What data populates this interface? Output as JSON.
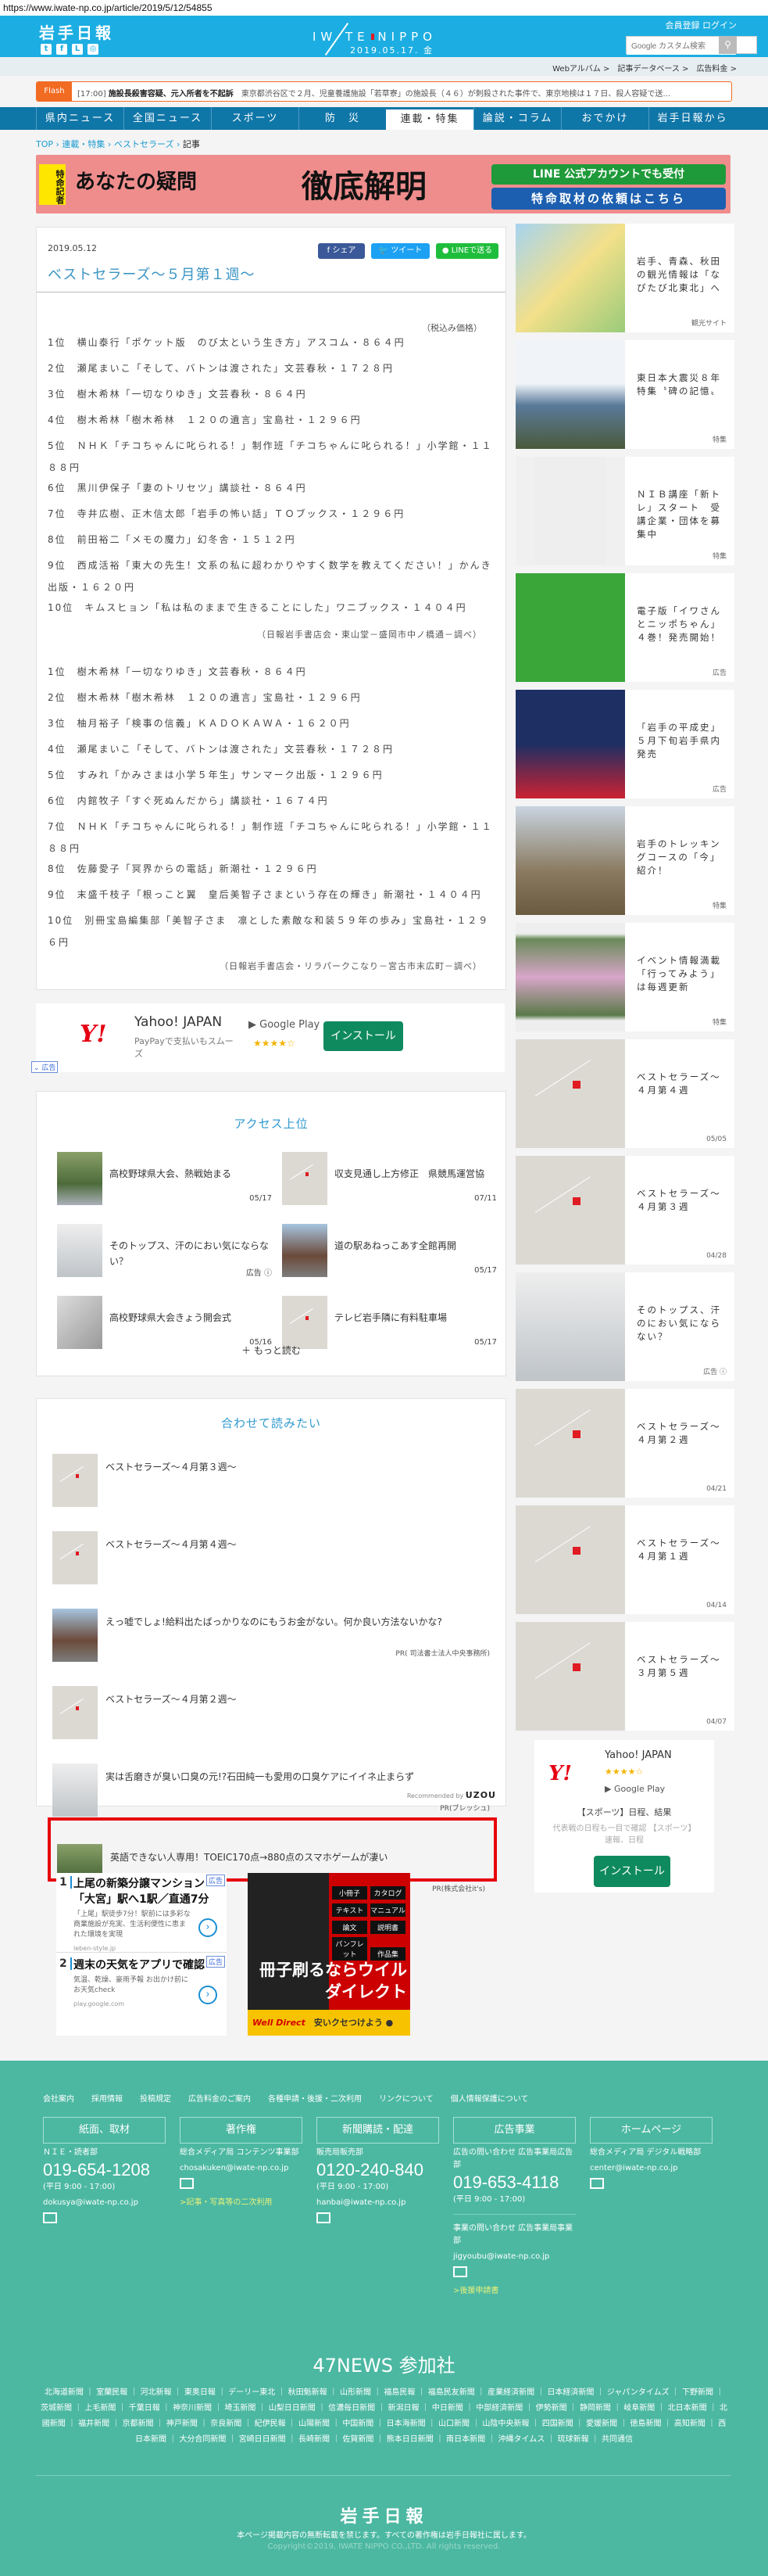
{
  "url": "https://www.iwate-np.co.jp/article/2019/5/12/54855",
  "header": {
    "logo_jp": "岩手日報",
    "brand": "IW  TE NIPPO",
    "date": "2019.05.17. 金",
    "account": "会員登録 ログイン",
    "search_placeholder": "Google カスタム検索",
    "search_icon": "search-icon",
    "social": [
      "twitter",
      "facebook",
      "line",
      "instagram"
    ]
  },
  "subnav": [
    "Webアルバム >",
    "記事データベース >",
    "広告料金 >"
  ],
  "flash": {
    "tag": "Flash",
    "time": "[17:00]",
    "headline": "施設長殺害容疑、元入所者を不起訴",
    "body": "東京都渋谷区で２月、児童養護施設「若草寮」の施設長（４６）が刺殺された事件で、東京地検は１７日、殺人容疑で送…"
  },
  "nav": [
    {
      "label": "県内ニュース"
    },
    {
      "label": "全国ニュース"
    },
    {
      "label": "スポーツ"
    },
    {
      "label": "防　災"
    },
    {
      "label": "連載・特集",
      "active": true
    },
    {
      "label": "論説・コラム"
    },
    {
      "label": "おでかけ"
    },
    {
      "label": "岩手日報から"
    }
  ],
  "breadcrumb": [
    "TOP",
    "連載・特集",
    "ベストセラーズ",
    "記事"
  ],
  "banner": {
    "tag": "特命記者",
    "text1": "あなたの疑問",
    "text2": "徹底解明",
    "line": "LINE 公式アカウントでも受付",
    "request": "特命取材の依頼はこちら"
  },
  "article": {
    "date": "2019.05.12",
    "title": "ベストセラーズ～５月第１週～",
    "share": {
      "facebook": "シェア",
      "twitter": "ツイート",
      "line": "LINEで送る"
    },
    "tax_note": "（税込み価格）",
    "list1": [
      "1位　横山泰行「ポケット版　のび太という生き方」アスコム・８６４円",
      "2位　瀬尾まいこ「そして、バトンは渡された」文芸春秋・１７２８円",
      "3位　樹木希林「一切なりゆき」文芸春秋・８６４円",
      "4位　樹木希林「樹木希林　１２０の遺言」宝島社・１２９６円",
      "5位　ＮＨＫ「チコちゃんに叱られる！」制作班「チコちゃんに叱られる！」小学館・１１８８円",
      "6位　黒川伊保子「妻のトリセツ」講談社・８６４円",
      "7位　寺井広樹、正木信太郎「岩手の怖い話」ＴＯブックス・１２９６円",
      "8位　前田裕二「メモの魔力」幻冬舎・１５１２円",
      "9位　西成活裕「東大の先生！文系の私に超わかりやすく数学を教えてください！」かんき出版・１６２０円",
      "10位　キムスヒョン「私は私のままで生きることにした」ワニブックス・１４０４円"
    ],
    "source1": "（日報岩手書店会・東山堂－盛岡市中ノ橋通－調べ）",
    "list2": [
      "1位　樹木希林「一切なりゆき」文芸春秋・８６４円",
      "2位　樹木希林「樹木希林　１２０の遺言」宝島社・１２９６円",
      "3位　柚月裕子「検事の信義」ＫＡＤＯＫＡＷＡ・１６２０円",
      "4位　瀬尾まいこ「そして、バトンは渡された」文芸春秋・１７２８円",
      "5位　すみれ「かみさまは小学５年生」サンマーク出版・１２９６円",
      "6位　内館牧子「すぐ死ぬんだから」講談社・１６７４円",
      "7位　ＮＨＫ「チコちゃんに叱られる！」制作班「チコちゃんに叱られる！」小学館・１１８８円",
      "8位　佐藤愛子「冥界からの電話」新潮社・１２９６円",
      "9位　末盛千枝子「根っこと翼　皇后美智子さまという存在の輝き」新潮社・１４０４円",
      "10位　別冊宝島編集部「美智子さま　凛とした素敵な和装５９年の歩み」宝島社・１２９６円"
    ],
    "source2": "（日報岩手書店会・リラパークこなり－宮古市末広町－調べ）"
  },
  "yahoo_ad": {
    "logo": "Y!",
    "name": "Yahoo! JAPAN",
    "desc": "PayPayで支払いもスムーズ",
    "store": "Google Play",
    "stars": "★★★★☆",
    "rating": 4,
    "install": "インストール",
    "ad_label": "広告"
  },
  "access": {
    "title": "アクセス上位",
    "items": [
      {
        "title": "高校野球県大会、熱戦始まる",
        "date": "05/17",
        "thumb": "photo1"
      },
      {
        "title": "収支見通し上方修正　県競馬運営協",
        "date": "07/11",
        "thumb": "ph"
      },
      {
        "title": "そのトップス、汗のにおい気にならない？",
        "date": "広告 ⓘ",
        "thumb": "photo2"
      },
      {
        "title": "道の駅あねっこあす全館再開",
        "date": "05/17",
        "thumb": "photo3"
      },
      {
        "title": "高校野球県大会きょう開会式",
        "date": "05/16",
        "thumb": "photo4"
      },
      {
        "title": "テレビ岩手隣に有料駐車場",
        "date": "05/17",
        "thumb": "ph"
      }
    ],
    "more": "＋ もっと読む"
  },
  "together": {
    "title": "合わせて読みたい",
    "items": [
      {
        "title": "ベストセラーズ～４月第３週～",
        "pr": "",
        "thumb": "ph"
      },
      {
        "title": "ベストセラーズ～４月第４週～",
        "pr": "",
        "thumb": "ph"
      },
      {
        "title": "えっ嘘でしょ!給料出たばっかりなのにもうお金がない。何か良い方法ないかな?",
        "pr": "PR( 司法書士法人中央事務所)",
        "thumb": "photo3"
      },
      {
        "title": "ベストセラーズ～４月第２週～",
        "pr": "",
        "thumb": "ph"
      },
      {
        "title": "実は舌磨きが臭い口臭の元!?石田純一も愛用の口臭ケアにイイネ止まらず",
        "pr": "PR(ブレッシュ)",
        "thumb": "photo2"
      },
      {
        "title": "英語できない人専用！TOEIC170点→880点のスマホゲームが凄い",
        "pr": "PR(株式会社it's)",
        "thumb": "photo1"
      }
    ],
    "recommended": "Recommended by",
    "uzou": "UZOU"
  },
  "ads": {
    "items": [
      {
        "num": "1",
        "head": "上尾の新築分譲マンション - 「大宮」駅へ1駅／直通7分",
        "sub": "「上尾」駅徒歩7分！駅前には多彩な商業施設が充実、生活利便性に恵まれた環境を実現",
        "url": "leben-style.jp",
        "tag": "広告"
      },
      {
        "num": "2",
        "head": "週末の天気をアプリで確認",
        "sub": "気温、乾燥、豪雨予報 お出かけ前にお天気check",
        "url": "play.google.com",
        "tag": "広告"
      }
    ],
    "welldirect": {
      "chips": [
        "小冊子",
        "カタログ",
        "テキスト",
        "マニュアル",
        "論文",
        "説明書",
        "パンフレット",
        "作品集"
      ],
      "headline": "冊子刷るならウイルダイレクト",
      "brand": "Well Direct",
      "cta": "安いクセつけよう"
    }
  },
  "sidebar": [
    {
      "title": "岩手、青森、秋田の観光情報は「なぴたび北東北」へ",
      "tag": "観光サイト",
      "thumb": "map"
    },
    {
      "title": "東日本大震災８年特集〝碑の記憶〟",
      "tag": "特集",
      "thumb": "quake"
    },
    {
      "title": "ＮＩＢ講座「新トレ」スタート　受講企業・団体を募集中",
      "tag": "特集",
      "thumb": "nib"
    },
    {
      "title": "電子版「イワさんとニッポちゃん」４巻！発売開始！",
      "tag": "広告",
      "thumb": "manga"
    },
    {
      "title": "「岩手の平成史」５月下旬岩手県内発売",
      "tag": "広告",
      "thumb": "heisei"
    },
    {
      "title": "岩手のトレッキングコースの「今」紹介！",
      "tag": "特集",
      "thumb": "forest"
    },
    {
      "title": "イベント情報満載「行ってみよう」は毎週更新",
      "tag": "特集",
      "thumb": "flowers"
    },
    {
      "title": "ベストセラーズ～４月第４週",
      "tag": "05/05",
      "thumb": "ph"
    },
    {
      "title": "ベストセラーズ～４月第３週",
      "tag": "04/28",
      "thumb": "ph"
    },
    {
      "title": "そのトップス、汗のにおい気にならない？",
      "tag": "広告 ⓘ",
      "thumb": "photo2"
    },
    {
      "title": "ベストセラーズ～４月第２週",
      "tag": "04/21",
      "thumb": "ph"
    },
    {
      "title": "ベストセラーズ～４月第１週",
      "tag": "04/14",
      "thumb": "ph"
    },
    {
      "title": "ベストセラーズ～３月第５週",
      "tag": "04/07",
      "thumb": "ph"
    }
  ],
  "side_ad": {
    "logo": "Y!",
    "name": "Yahoo! JAPAN",
    "stars": "★★★★☆",
    "store": "Google Play",
    "head": "【スポーツ】日程、結果",
    "desc": "代表戦の日程も一目で確認 【スポーツ】速報、日程",
    "install": "インストール"
  },
  "footer": {
    "links": [
      "会社案内",
      "採用情報",
      "投稿規定",
      "広告料金のご案内",
      "各種申請・後援・二次利用",
      "リンクについて",
      "個人情報保護について"
    ],
    "cols": [
      {
        "head": "紙面、取材",
        "dept": "ＮＩＥ・読者部",
        "phone": "019-654-1208",
        "hours": "(平日 9:00 - 17:00)",
        "email": "dokusya@iwate-np.co.jp"
      },
      {
        "head": "著作権",
        "dept": "総合メディア局 コンテンツ事業部",
        "email": "chosakuken@iwate-np.co.jp",
        "link": ">記事・写真等の二次利用"
      },
      {
        "head": "新聞購読・配達",
        "dept": "販売局販売部",
        "phone": "0120-240-840",
        "hours": "(平日 9:00 - 17:00)",
        "email": "hanbai@iwate-np.co.jp"
      },
      {
        "head": "広告事業",
        "dept": "広告の問い合わせ 広告事業局広告部",
        "phone": "019-653-4118",
        "hours": "(平日 9:00 - 17:00)",
        "dept2": "事業の問い合わせ 広告事業局事業部",
        "email": "jigyoubu@iwate-np.co.jp",
        "link": ">後援申請書"
      },
      {
        "head": "ホームページ",
        "dept": "総合メディア局 デジタル戦略部",
        "email": "center@iwate-np.co.jp"
      }
    ],
    "news47_title": "47NEWS 参加社",
    "news47": [
      "北海道新聞",
      "室蘭民報",
      "河北新報",
      "東奥日報",
      "デーリー東北",
      "秋田魁新報",
      "山形新聞",
      "福島民報",
      "福島民友新聞",
      "産業経済新聞",
      "日本経済新聞",
      "ジャパンタイムズ",
      "下野新聞",
      "茨城新聞",
      "上毛新聞",
      "千葉日報",
      "神奈川新聞",
      "埼玉新聞",
      "山梨日日新聞",
      "信濃毎日新聞",
      "新潟日報",
      "中日新聞",
      "中部経済新聞",
      "伊勢新聞",
      "静岡新聞",
      "岐阜新聞",
      "北日本新聞",
      "北國新聞",
      "福井新聞",
      "京都新聞",
      "神戸新聞",
      "奈良新聞",
      "紀伊民報",
      "山陽新聞",
      "中国新聞",
      "日本海新聞",
      "山口新聞",
      "山陰中央新報",
      "四国新聞",
      "愛媛新聞",
      "徳島新聞",
      "高知新聞",
      "西日本新聞",
      "大分合同新聞",
      "宮崎日日新聞",
      "長崎新聞",
      "佐賀新聞",
      "熊本日日新聞",
      "南日本新聞",
      "沖縄タイムス",
      "琉球新報",
      "共同通信"
    ],
    "logo": "岩手日報",
    "notice": "本ページ掲載内容の無断転載を禁じます。すべての著作権は岩手日報社に属します。",
    "copyright": "Copyright©2019, IWATE NIPPO CO.,LTD. All rights reserved."
  },
  "colors": {
    "header": "#1caee2",
    "nav": "#0f76a8",
    "flash": "#f26b22",
    "accent": "#3b95c4",
    "footer": "#4cb8a2",
    "highlight": "#e8000b"
  }
}
